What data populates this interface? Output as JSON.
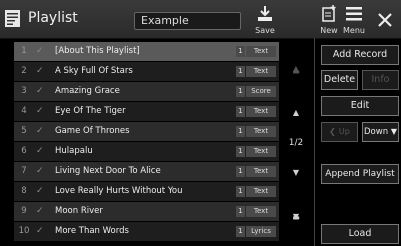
{
  "header": {
    "title": "Playlist",
    "name_value": "Example",
    "save_label": "Save",
    "new_label": "New",
    "menu_label": "Menu"
  },
  "list": {
    "rows": [
      {
        "num": "1",
        "name": "[About This Playlist]",
        "count": "1",
        "type": "Text",
        "selected": true
      },
      {
        "num": "2",
        "name": "A Sky Full Of Stars",
        "count": "1",
        "type": "Text",
        "selected": false
      },
      {
        "num": "3",
        "name": "Amazing Grace",
        "count": "1",
        "type": "Score",
        "selected": false
      },
      {
        "num": "4",
        "name": "Eye Of The Tiger",
        "count": "1",
        "type": "Text",
        "selected": false
      },
      {
        "num": "5",
        "name": "Game Of Thrones",
        "count": "1",
        "type": "Text",
        "selected": false
      },
      {
        "num": "6",
        "name": "Hulapalu",
        "count": "1",
        "type": "Text",
        "selected": false
      },
      {
        "num": "7",
        "name": "Living Next Door To Alice",
        "count": "1",
        "type": "Text",
        "selected": false
      },
      {
        "num": "8",
        "name": "Love Really Hurts Without You",
        "count": "1",
        "type": "Text",
        "selected": false
      },
      {
        "num": "9",
        "name": "Moon River",
        "count": "1",
        "type": "Text",
        "selected": false
      },
      {
        "num": "10",
        "name": "More Than Words",
        "count": "1",
        "type": "Lyrics",
        "selected": false
      }
    ],
    "page_indicator": "1/2"
  },
  "side": {
    "add_record": "Add Record",
    "delete": "Delete",
    "info": "Info",
    "edit": "Edit",
    "up": "Up",
    "down": "Down",
    "append_playlist": "Append Playlist",
    "load": "Load"
  },
  "icons": {
    "app": "playlist-icon",
    "save": "save-icon",
    "new": "new-icon",
    "menu": "menu-icon",
    "close": "close-icon"
  },
  "colors": {
    "selected_row": "#5a5a5a",
    "background": "#000000"
  }
}
